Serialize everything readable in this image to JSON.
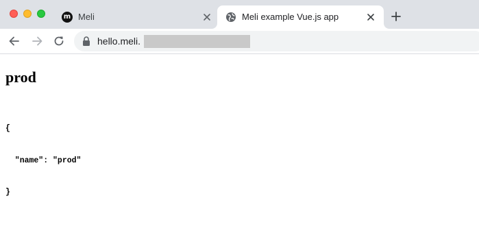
{
  "tabs": [
    {
      "title": "Meli",
      "favicon_letter": "m",
      "favicon": "meli-logo-icon",
      "active": false
    },
    {
      "title": "Meli example Vue.js app",
      "favicon": "globe-icon",
      "active": true
    }
  ],
  "toolbar": {
    "url": "hello.meli."
  },
  "page": {
    "heading": "prod",
    "json_lines": [
      "{",
      "  \"name\": \"prod\"",
      "}"
    ]
  },
  "colors": {
    "tabstrip": "#dee1e6",
    "omnibox": "#f1f3f4",
    "redaction": "#c9c9c9",
    "traffic_close": "#ff5f57",
    "traffic_min": "#febc2e",
    "traffic_max": "#28c840"
  }
}
